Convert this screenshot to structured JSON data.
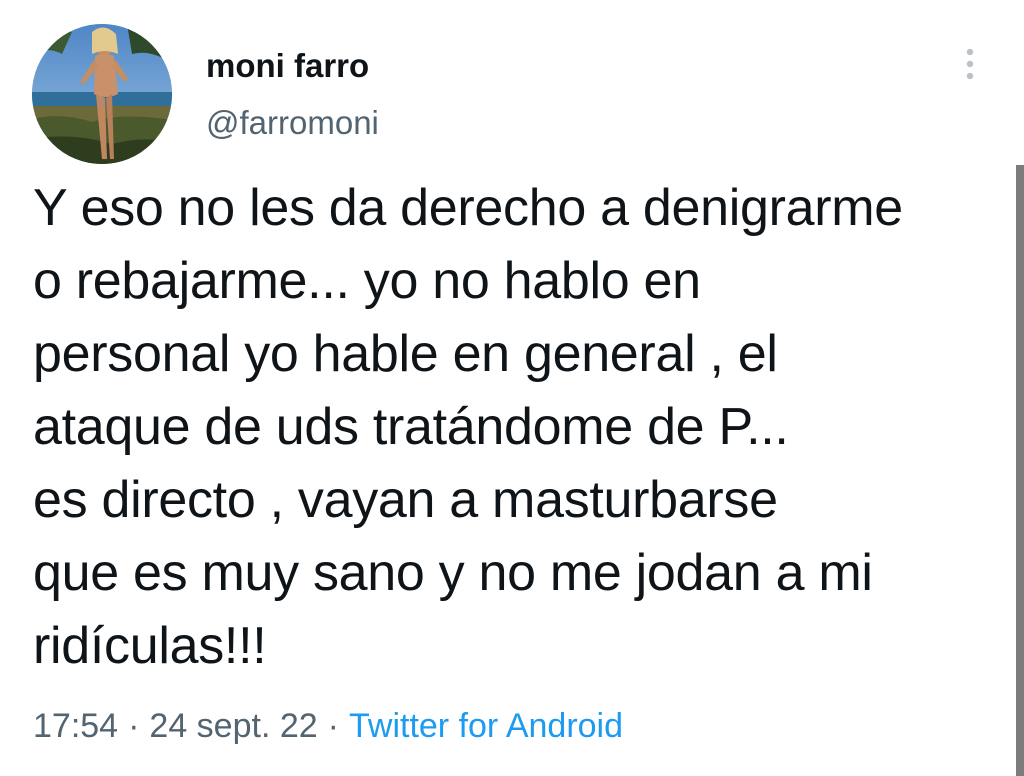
{
  "author": {
    "display_name": "moni farro",
    "handle": "@farromoni"
  },
  "tweet": {
    "lines": [
      "Y eso no les da derecho a denigrarme",
      "o rebajarme... yo no hablo en",
      "personal yo hable en general , el",
      "ataque de uds tratándome de P...",
      "es directo , vayan a masturbarse",
      "que es muy sano y no me jodan a mi",
      "ridículas!!!"
    ]
  },
  "meta": {
    "time": "17:54",
    "separator": "·",
    "date": "24 sept. 22",
    "source": "Twitter for Android"
  },
  "icons": {
    "more": "more-vertical-icon"
  },
  "colors": {
    "text": "#0f1419",
    "secondary": "#536471",
    "link": "#1d9bf0"
  }
}
